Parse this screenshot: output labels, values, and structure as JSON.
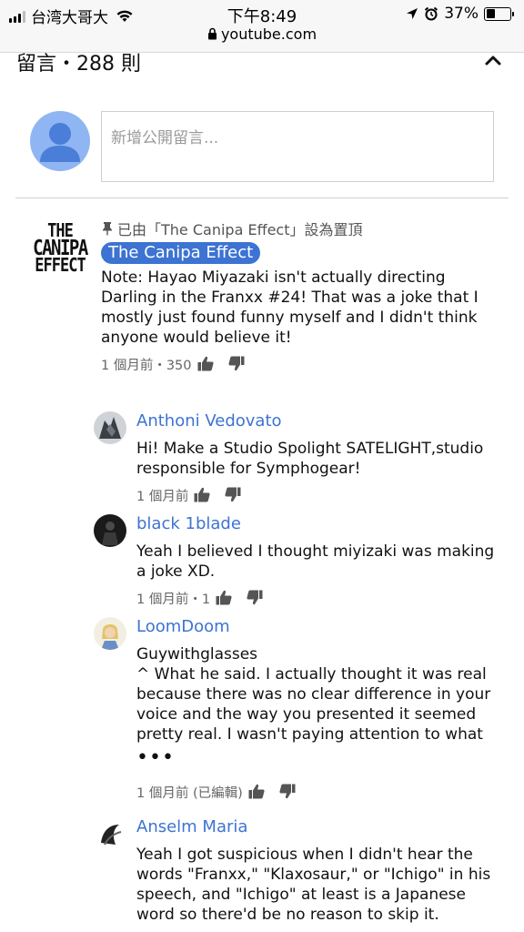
{
  "status_bar": {
    "carrier": "台湾大哥大",
    "time": "下午8:49",
    "url": "youtube.com",
    "battery": "37%",
    "battery_level": 0.37
  },
  "comments": {
    "title": "留言・288 則",
    "input_placeholder": "新增公開留言..."
  },
  "top_comment": {
    "logo_lines": [
      "THE",
      "CANIPA",
      "EFFECT"
    ],
    "pinned_text": "已由「The Canipa Effect」設為置頂",
    "author": "The Canipa Effect",
    "text": "Note: Hayao Miyazaki isn't actually directing Darling in the Franxx #24! That was a joke that I mostly just found funny myself and I didn't think anyone would believe it!",
    "meta": "1 個月前・350"
  },
  "replies": [
    {
      "author": "Anthoni Vedovato",
      "text": "Hi! Make a Studio Spolight SATELIGHT,studio responsible for Symphogear!",
      "meta": "1 個月前"
    },
    {
      "author": "black 1blade",
      "text": "Yeah I believed I thought miyizaki was making a joke XD.",
      "meta": "1 個月前・1"
    },
    {
      "author": "LoomDoom",
      "text_line1": "Guywithglasses",
      "text": "^ What he said. I actually thought it was real because there was no clear difference in your voice and the way you presented it seemed pretty real. I wasn't paying attention to what",
      "more": "•••",
      "meta": "1 個月前 (已編輯)"
    },
    {
      "author": "Anselm Maria",
      "text": "Yeah I got suspicious when I didn't hear the words \"Franxx,\" \"Klaxosaur,\" or \"Ichigo\" in his speech, and \"Ichigo\" at least is a Japanese word so there'd be no reason to skip it."
    }
  ],
  "colors": {
    "accent": "#3d73d2",
    "avatar_blue": "#8fb5f3",
    "avatar_dark": "#4a7ed8"
  }
}
